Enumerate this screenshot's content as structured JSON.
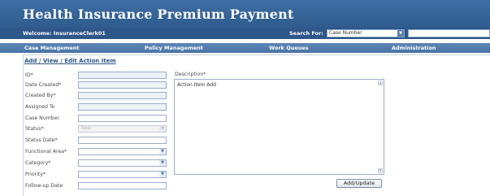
{
  "app": {
    "title": "Health Insurance Premium Payment"
  },
  "topbar": {
    "welcome": "Welcome: InsuranceClerk01",
    "search_label": "Search For:",
    "search_select_value": "Case Number"
  },
  "nav": {
    "items": [
      {
        "label": "Case Management"
      },
      {
        "label": "Policy Management"
      },
      {
        "label": "Work Queues"
      },
      {
        "label": "Administration"
      }
    ]
  },
  "form": {
    "title": "Add / View / Edit Action Item",
    "fields": [
      {
        "label": "ID*",
        "value": ""
      },
      {
        "label": "Date Created*",
        "value": ""
      },
      {
        "label": "Created By*",
        "value": ""
      },
      {
        "label": "Assigned To",
        "value": ""
      },
      {
        "label": "Case Number",
        "value": ""
      },
      {
        "label": "Status*",
        "value": "New"
      },
      {
        "label": "Status Date*",
        "value": ""
      },
      {
        "label": "Functional Area*",
        "value": ""
      },
      {
        "label": "Category*",
        "value": ""
      },
      {
        "label": "Priority*",
        "value": ""
      },
      {
        "label": "Follow-up Date",
        "value": ""
      }
    ],
    "description_label": "Description*",
    "description_value": "Action Item Add",
    "submit_label": "Add/Update"
  },
  "colors": {
    "header": "#3e6fa4",
    "topbar": "#2d5689",
    "navbar": "#4a74a6",
    "accent": "#2d5689"
  }
}
